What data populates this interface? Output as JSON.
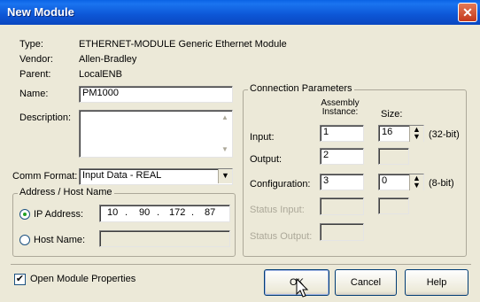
{
  "window": {
    "title": "New Module",
    "close_icon": "close-icon"
  },
  "info": {
    "type_label": "Type:",
    "type_value": "ETHERNET-MODULE Generic Ethernet Module",
    "vendor_label": "Vendor:",
    "vendor_value": "Allen-Bradley",
    "parent_label": "Parent:",
    "parent_value": "LocalENB",
    "name_label": "Name:",
    "name_value": "PM1000",
    "description_label": "Description:",
    "description_value": ""
  },
  "comm_format": {
    "label": "Comm Format:",
    "value": "Input Data - REAL"
  },
  "address": {
    "group_title": "Address / Host Name",
    "ip_label": "IP Address:",
    "ip_octets": [
      "10",
      "90",
      "172",
      "87"
    ],
    "host_label": "Host Name:",
    "host_value": ""
  },
  "connection": {
    "group_title": "Connection Parameters",
    "col_instance": "Assembly\nInstance:",
    "col_size": "Size:",
    "rows": [
      {
        "label": "Input:",
        "instance": "1",
        "size": "16",
        "unit": "(32-bit)"
      },
      {
        "label": "Output:",
        "instance": "2",
        "size": "",
        "unit": ""
      },
      {
        "label": "Configuration:",
        "instance": "3",
        "size": "0",
        "unit": "(8-bit)"
      },
      {
        "label": "Status Input:",
        "instance": "",
        "size": "",
        "unit": ""
      },
      {
        "label": "Status Output:",
        "instance": "",
        "size": "",
        "unit": ""
      }
    ]
  },
  "footer": {
    "open_props_label": "Open Module Properties",
    "ok_label": "OK",
    "cancel_label": "Cancel",
    "help_label": "Help"
  },
  "colors": {
    "titlebar": "#0a54d8",
    "face": "#ece9d8"
  }
}
